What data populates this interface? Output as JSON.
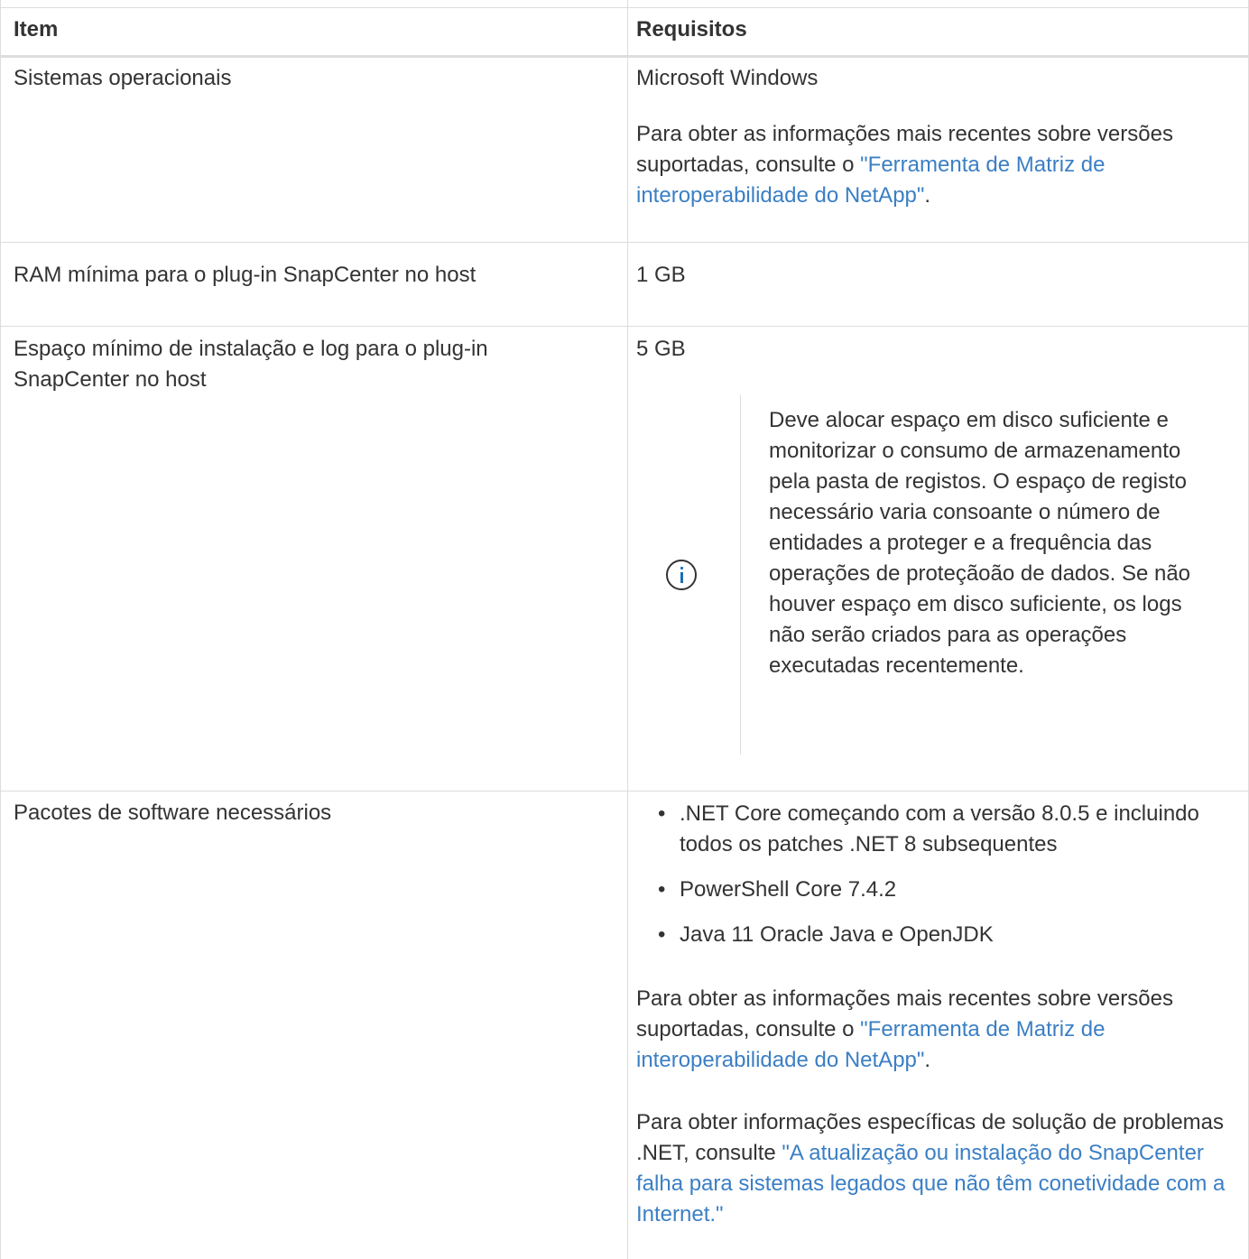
{
  "table": {
    "headers": [
      "Item",
      "Requisitos"
    ],
    "rows": [
      {
        "item": "Sistemas operacionais",
        "req_line1": "Microsoft Windows",
        "req_para_prefix": "Para obter as informações mais recentes sobre versões suportadas, consulte o ",
        "req_para_link": "\"Ferramenta de Matriz de interoperabilidade do NetApp\"",
        "req_para_suffix": "."
      },
      {
        "item": "RAM mínima para o plug-in SnapCenter no host",
        "req_line1": "1 GB"
      },
      {
        "item": "Espaço mínimo de instalação e log para o plug-in SnapCenter no host",
        "req_line1": "5 GB",
        "note_icon": "info-icon",
        "note_text": "Deve alocar espaço em disco suficiente e monitorizar o consumo de armazenamento pela pasta de registos. O espaço de registo necessário varia consoante o número de entidades a proteger e a frequência das operações de proteçãoão de dados. Se não houver espaço em disco suficiente, os logs não serão criados para as operações executadas recentemente."
      },
      {
        "item": "Pacotes de software necessários",
        "bullets": [
          ".NET Core começando com a versão 8.0.5 e incluindo todos os patches .NET 8 subsequentes",
          "PowerShell Core 7.4.2",
          "Java 11 Oracle Java e OpenJDK"
        ],
        "para1_prefix": "Para obter as informações mais recentes sobre versões suportadas, consulte o ",
        "para1_link": "\"Ferramenta de Matriz de interoperabilidade do NetApp\"",
        "para1_suffix": ".",
        "para2_prefix": "Para obter informações específicas de solução de problemas .NET, consulte ",
        "para2_link": "\"A atualização ou instalação do SnapCenter falha para sistemas legados que não têm conetividade com a Internet.\""
      }
    ]
  },
  "colors": {
    "link": "#3b7fc4",
    "border": "#dddddd",
    "text": "#333333",
    "icon_accent": "#1d6fb8"
  }
}
